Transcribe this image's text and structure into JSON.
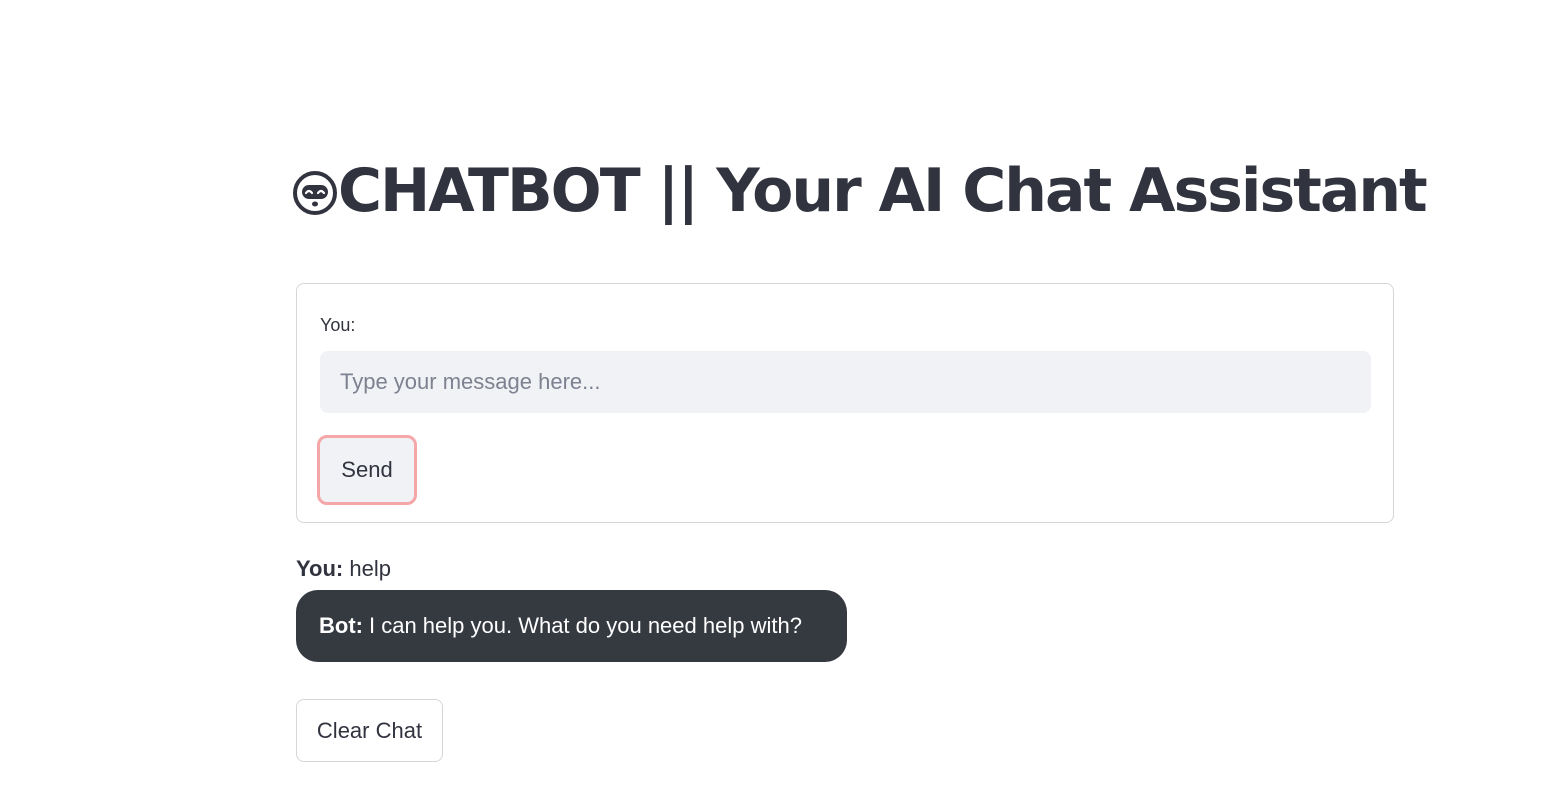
{
  "header": {
    "title": "CHATBOT || Your AI Chat Assistant",
    "title_icon": "robot-face-icon"
  },
  "form": {
    "label": "You:",
    "placeholder": "Type your message here...",
    "value": "",
    "send_label": "Send"
  },
  "chat": {
    "messages": [
      {
        "speaker": "You:",
        "text": "help"
      },
      {
        "speaker": "Bot:",
        "text": "I can help you. What do you need help with?"
      }
    ]
  },
  "actions": {
    "clear_label": "Clear Chat"
  },
  "colors": {
    "text": "#31333f",
    "input_bg": "#f0f2f6",
    "focus_outline": "#f4a6a8",
    "bot_bubble_bg": "#353a41",
    "border": "#d6d6d9"
  }
}
